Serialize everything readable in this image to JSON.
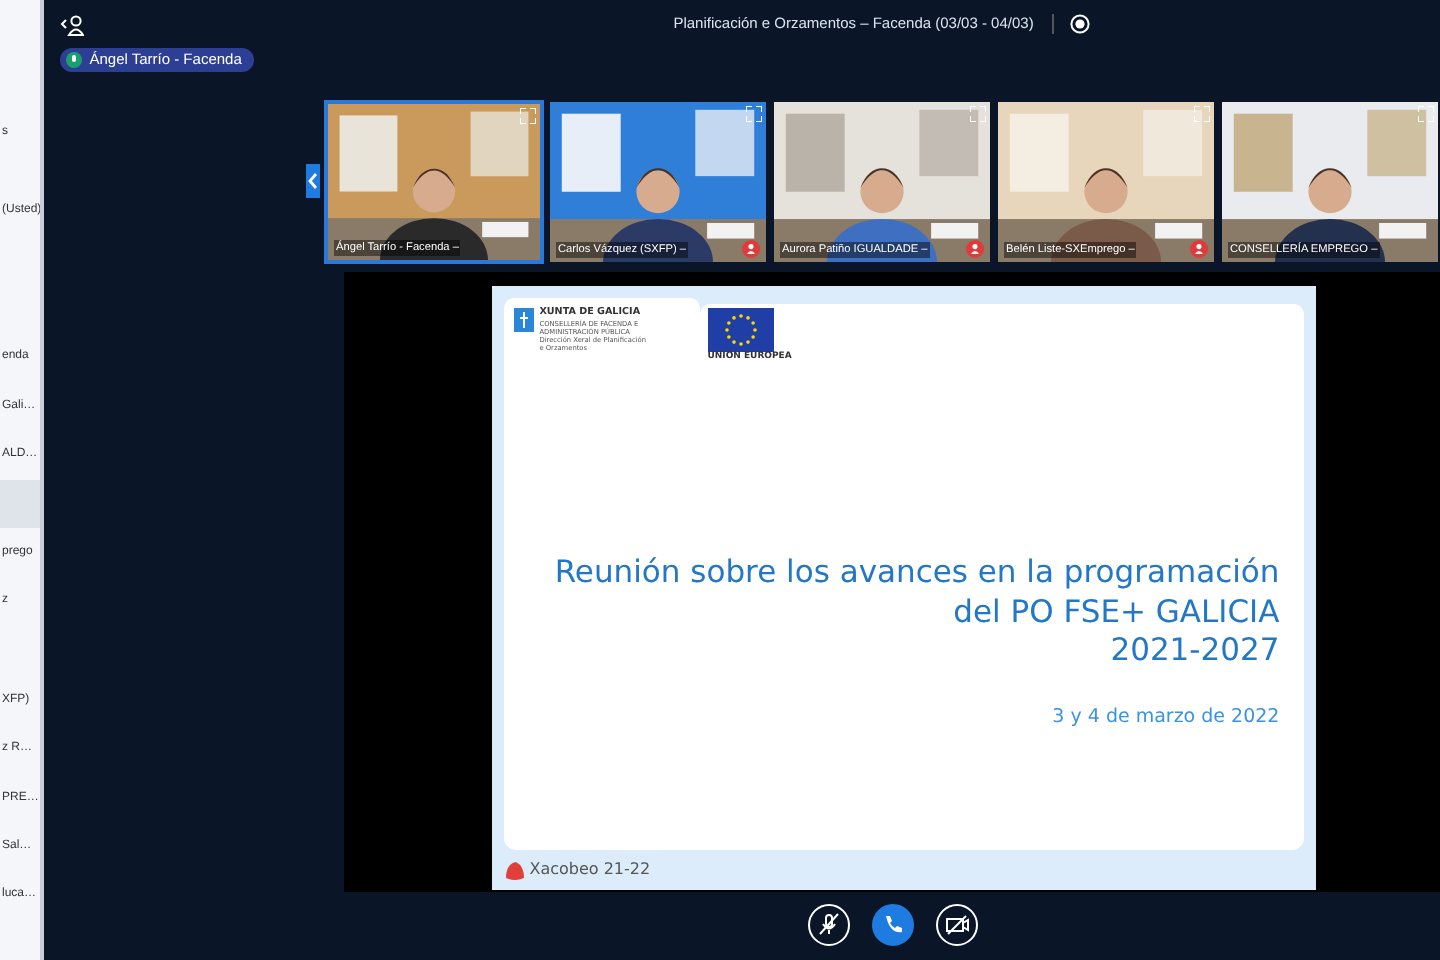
{
  "sidebar": {
    "items": [
      {
        "text": "s",
        "selected": false
      },
      {
        "text": "(Usted)",
        "selected": false
      },
      {
        "text": "enda",
        "selected": false
      },
      {
        "text": "Gali…",
        "selected": false
      },
      {
        "text": "ALD…",
        "selected": false
      },
      {
        "selected": true
      },
      {
        "text": "prego",
        "selected": false
      },
      {
        "text": "z",
        "selected": false
      },
      {
        "text": "XFP)",
        "selected": false
      },
      {
        "text": "z R…",
        "selected": false
      },
      {
        "text": "PRE…",
        "selected": false
      },
      {
        "text": "Sal…",
        "selected": false
      },
      {
        "text": "luca…",
        "selected": false
      }
    ]
  },
  "header": {
    "title": "Planificación e Orzamentos – Facenda (03/03 - 04/03)"
  },
  "speaker": {
    "name": "Ángel Tarrío - Facenda"
  },
  "videos": [
    {
      "name": "Ángel Tarrío - Facenda –",
      "selected": true,
      "muted": false
    },
    {
      "name": "Carlos Vázquez (SXFP) –",
      "selected": false,
      "muted": true
    },
    {
      "name": "Aurora Patiño IGUALDADE –",
      "selected": false,
      "muted": true
    },
    {
      "name": "Belén Liste-SXEmprego –",
      "selected": false,
      "muted": true
    },
    {
      "name": "CONSELLERÍA EMPREGO –",
      "selected": false,
      "muted": false
    }
  ],
  "slide": {
    "org": "XUNTA DE GALICIA",
    "org_lines": [
      "CONSELLERÍA DE FACENDA E",
      "ADMINISTRACIÓN PÚBLICA",
      "Dirección Xeral de Planificación",
      "e Orzamentos"
    ],
    "eu": "UNIÓN EUROPEA",
    "title_lines": [
      "Reunión sobre los avances en la programación",
      "del PO FSE+ GALICIA",
      "2021-2027"
    ],
    "date": "3 y 4 de marzo de 2022",
    "footer": "Xacobeo 21-22"
  },
  "controls": [
    {
      "kind": "mic"
    },
    {
      "kind": "hangup"
    },
    {
      "kind": "camera"
    }
  ]
}
